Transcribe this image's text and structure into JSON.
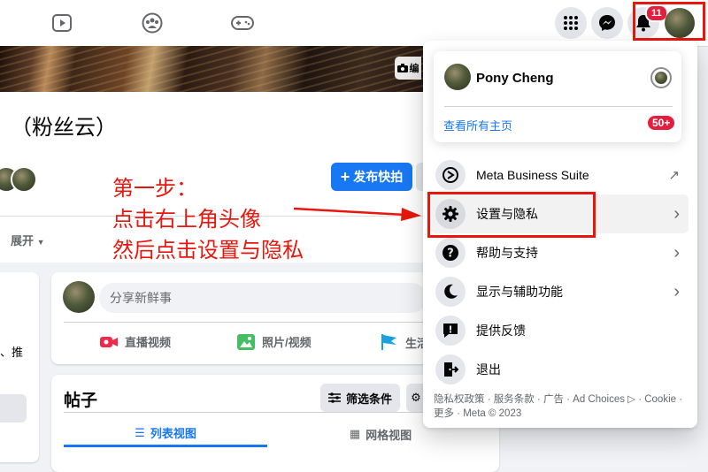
{
  "topnav": {
    "notification_badge": "11"
  },
  "cover": {
    "camera_label": "编"
  },
  "page": {
    "title": "（粉丝云）",
    "publish_button": "发布快拍",
    "expand_label": "展开",
    "left_partial_text": "、推"
  },
  "composer": {
    "placeholder": "分享新鲜事",
    "actions": [
      {
        "label": "直播视频",
        "icon": "live-video-icon",
        "color": "#f02849"
      },
      {
        "label": "照片/视频",
        "icon": "photo-icon",
        "color": "#45bd62"
      },
      {
        "label": "生活",
        "icon": "flag-icon",
        "color": "#1a9fe0"
      }
    ]
  },
  "posts": {
    "heading": "帖子",
    "filter_button": "筛选条件",
    "tabs": [
      {
        "label": "列表视图",
        "icon": "list-icon",
        "active": true
      },
      {
        "label": "网格视图",
        "icon": "grid-icon",
        "active": false
      }
    ]
  },
  "menu": {
    "profile_name": "Pony Cheng",
    "view_all_pages": "查看所有主页",
    "pages_badge": "50+",
    "items": [
      {
        "label": "Meta Business Suite",
        "icon": "meta-business-icon",
        "trailing": "↗"
      },
      {
        "label": "设置与隐私",
        "icon": "gear-icon",
        "trailing": "›"
      },
      {
        "label": "帮助与支持",
        "icon": "help-icon",
        "trailing": "›"
      },
      {
        "label": "显示与辅助功能",
        "icon": "moon-icon",
        "trailing": "›"
      },
      {
        "label": "提供反馈",
        "icon": "feedback-icon",
        "trailing": ""
      },
      {
        "label": "退出",
        "icon": "logout-icon",
        "trailing": ""
      }
    ],
    "footer": "隐私权政策 · 服务条款 · 广告 · Ad Choices ▷ · Cookie · 更多 · Meta © 2023"
  },
  "annotation": {
    "line1": "第一步：",
    "line2": "点击右上角头像",
    "line3": "然后点击设置与隐私",
    "color": "#e8160c"
  }
}
